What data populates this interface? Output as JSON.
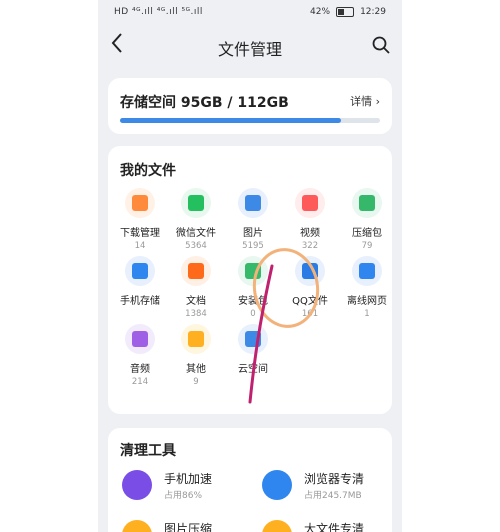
{
  "status": {
    "left": "HD ⁴ᴳ.ıll ⁴ᴳ.ıll ⁵ᴳ.ıll",
    "battery": "42%",
    "time": "12:29"
  },
  "header": {
    "title": "文件管理",
    "back_icon": "chevron-left-icon",
    "search_icon": "search-icon"
  },
  "storage": {
    "label": "存储空间 95GB / 112GB",
    "more": "详情 ›",
    "used_fraction": 0.85
  },
  "files": {
    "title": "我的文件",
    "items": [
      {
        "name": "下载管理",
        "count": "14",
        "icon": "download-icon",
        "color": "#ff8a3c",
        "bg": "#fff1e6"
      },
      {
        "name": "微信文件",
        "count": "5364",
        "icon": "wechat-icon",
        "color": "#24c060",
        "bg": "#e8f8ee"
      },
      {
        "name": "图片",
        "count": "5195",
        "icon": "image-icon",
        "color": "#3d8ae6",
        "bg": "#e7f0fc"
      },
      {
        "name": "视频",
        "count": "322",
        "icon": "video-icon",
        "color": "#ff5a5a",
        "bg": "#ffecec"
      },
      {
        "name": "压缩包",
        "count": "79",
        "icon": "archive-icon",
        "color": "#35b86a",
        "bg": "#e8f7ef"
      },
      {
        "name": "手机存储",
        "count": "",
        "icon": "phone-icon",
        "color": "#2f86ee",
        "bg": "#e7f0fc"
      },
      {
        "name": "文档",
        "count": "1384",
        "icon": "document-icon",
        "color": "#ff6a1a",
        "bg": "#fff0e6"
      },
      {
        "name": "安装包",
        "count": "0",
        "icon": "android-icon",
        "color": "#36b96a",
        "bg": "#e8f7ef"
      },
      {
        "name": "QQ文件",
        "count": "161",
        "icon": "qq-icon",
        "color": "#2a7be4",
        "bg": "#e7f0fc"
      },
      {
        "name": "离线网页",
        "count": "1",
        "icon": "webpage-icon",
        "color": "#2f86ee",
        "bg": "#e7f0fc"
      },
      {
        "name": "音频",
        "count": "214",
        "icon": "music-icon",
        "color": "#a060e6",
        "bg": "#f2ebfc"
      },
      {
        "name": "其他",
        "count": "9",
        "icon": "folder-icon",
        "color": "#ffb020",
        "bg": "#fff6e0"
      },
      {
        "name": "云空间",
        "count": "",
        "icon": "cloud-icon",
        "color": "#3d8ae6",
        "bg": "#e7f0fc"
      }
    ]
  },
  "clean": {
    "title": "清理工具",
    "tools": [
      {
        "name": "手机加速",
        "sub": "占用86%",
        "icon": "rocket-icon",
        "color": "#7a4de6"
      },
      {
        "name": "浏览器专清",
        "sub": "占用245.7MB",
        "icon": "browser-icon",
        "color": "#2f86ee"
      },
      {
        "name": "图片压缩",
        "sub": "",
        "icon": "image-compress-icon",
        "color": "#ffb020"
      },
      {
        "name": "大文件专清",
        "sub": "",
        "icon": "big-file-icon",
        "color": "#ffb020"
      }
    ]
  }
}
